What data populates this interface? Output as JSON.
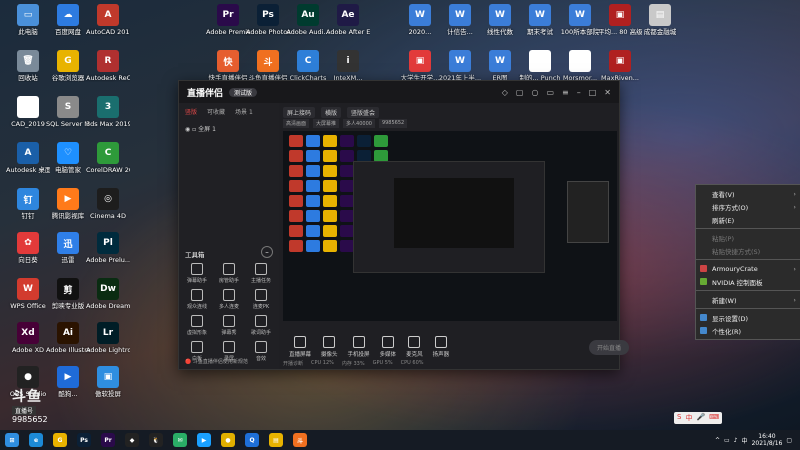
{
  "desktop": {
    "icons": [
      {
        "label": "此电脑",
        "color": "#4a90d9",
        "glyph": "▭"
      },
      {
        "label": "百度网盘",
        "color": "#2d7be0",
        "glyph": "☁"
      },
      {
        "label": "AutoCAD 2019 - 简...",
        "color": "#c0392b",
        "glyph": "A"
      },
      {
        "label": "Adobe Premie...",
        "color": "#2a0a4a",
        "glyph": "Pr"
      },
      {
        "label": "Adobe Photosh...",
        "color": "#0b2036",
        "glyph": "Ps"
      },
      {
        "label": "Adobe Audi...",
        "color": "#003b2f",
        "glyph": "Au"
      },
      {
        "label": "Adobe After Effects CC",
        "color": "#1f1a46",
        "glyph": "Ae"
      },
      {
        "label": "回收站",
        "color": "#7a8a99",
        "glyph": "🗑"
      },
      {
        "label": "谷歌浏览器",
        "color": "#e8b300",
        "glyph": "G"
      },
      {
        "label": "Autodesk ReCap",
        "color": "#b03030",
        "glyph": "R"
      },
      {
        "label": "快手直播伴侣",
        "color": "#e65e2f",
        "glyph": "快"
      },
      {
        "label": "斗鱼直播伴侣",
        "color": "#f07020",
        "glyph": "斗"
      },
      {
        "label": "ClickCharts",
        "color": "#2e7fd8",
        "glyph": "C"
      },
      {
        "label": "InteXM...",
        "color": "#333",
        "glyph": "i"
      },
      {
        "label": "CAD_2019",
        "color": "#fff",
        "glyph": "▤"
      },
      {
        "label": "SQL Server Managem...",
        "color": "#8a8a8a",
        "glyph": "S"
      },
      {
        "label": "3ds Max 2019",
        "color": "#1a6e6e",
        "glyph": "3"
      },
      {
        "label": "Autodesk 桌面应用程序",
        "color": "#1a5fa8",
        "glyph": "A"
      },
      {
        "label": "电脑管家",
        "color": "#1e90ff",
        "glyph": "♡"
      },
      {
        "label": "CorelDRAW 2020 (64...",
        "color": "#2e9a3a",
        "glyph": "C"
      },
      {
        "label": "钉钉",
        "color": "#2e86de",
        "glyph": "钉"
      },
      {
        "label": "腾讯影视库",
        "color": "#ff7a1a",
        "glyph": "▶"
      },
      {
        "label": "Cinema 4D",
        "color": "#1d1d1d",
        "glyph": "◎"
      },
      {
        "label": "向日葵",
        "color": "#e23a3a",
        "glyph": "✿"
      },
      {
        "label": "迅雷",
        "color": "#2f7fe8",
        "glyph": "迅"
      },
      {
        "label": "Adobe Prelu...",
        "color": "#002b3d",
        "glyph": "Pl"
      },
      {
        "label": "WPS Office",
        "color": "#d23b2e",
        "glyph": "W"
      },
      {
        "label": "剪映专业版",
        "color": "#111",
        "glyph": "剪"
      },
      {
        "label": "Adobe Dreamwe...",
        "color": "#0a2c12",
        "glyph": "Dw"
      },
      {
        "label": "Adobe XD",
        "color": "#470137",
        "glyph": "Xd"
      },
      {
        "label": "Adobe Illustrat...",
        "color": "#2b1300",
        "glyph": "Ai"
      },
      {
        "label": "Adobe Lightroo...",
        "color": "#001d26",
        "glyph": "Lr"
      },
      {
        "label": "OBS Studio",
        "color": "#222",
        "glyph": "●"
      },
      {
        "label": "酷狗...",
        "color": "#1f6bd8",
        "glyph": "▶"
      },
      {
        "label": "傲软投屏",
        "color": "#2f8ee0",
        "glyph": "▣"
      },
      {
        "label": "2020...",
        "color": "#3b7dd8",
        "glyph": "W"
      },
      {
        "label": "计信告...",
        "color": "#3b7dd8",
        "glyph": "W"
      },
      {
        "label": "线性代数",
        "color": "#3b7dd8",
        "glyph": "W"
      },
      {
        "label": "期末考试",
        "color": "#3b7dd8",
        "glyph": "W"
      },
      {
        "label": "100所本部院",
        "color": "#3b7dd8",
        "glyph": "W"
      },
      {
        "label": "平均... 80 高级中学",
        "color": "#b02020",
        "glyph": "▣"
      },
      {
        "label": "成都金融城",
        "color": "#c9c9c9",
        "glyph": "▤"
      },
      {
        "label": "大学生开学...",
        "color": "#e23a3a",
        "glyph": "▣"
      },
      {
        "label": "2021年上半...",
        "color": "#3b7dd8",
        "glyph": "W"
      },
      {
        "label": "ER图",
        "color": "#3b7dd8",
        "glyph": "W"
      },
      {
        "label": "制的... Punch",
        "color": "#fff",
        "glyph": "▤"
      },
      {
        "label": "Morsmor...",
        "color": "#fff",
        "glyph": "▤"
      },
      {
        "label": "MaxRiven...",
        "color": "#b02020",
        "glyph": "▣"
      }
    ]
  },
  "app": {
    "name": "直播伴侣",
    "version": "测试版",
    "scene_tabs": [
      "竖版",
      "可收藏",
      "场景 1"
    ],
    "scene_item": "全屏 1",
    "preview_tabs": [
      "屏上接码",
      "横版",
      "竖版盛会"
    ],
    "preview_sub": [
      "高清画面",
      "大屏幕推",
      "多人40000",
      "9985652"
    ],
    "tools_title": "工具箱",
    "tools": [
      "弹幕助手",
      "房管助手",
      "主播任务",
      "观众连线",
      "多人连麦",
      "连麦PK",
      "虚拟形象",
      "弹幕秀",
      "歌词助手",
      "白板",
      "录屏",
      "音效"
    ],
    "notice": "斗鱼直播伴侣使用新规范",
    "bottom_buttons": [
      "直播屏幕",
      "摄像头",
      "手机投屏",
      "多媒体",
      "麦克风",
      "扬声器"
    ],
    "golive": "开始直播",
    "footer_links": [
      "开播诊断",
      "CPU 12%",
      "内存 33%",
      "GPU 5%",
      "CPU 60%"
    ],
    "toolbar_icons": [
      "gift",
      "shop",
      "user",
      "chat",
      "settings",
      "minimize",
      "maximize",
      "close"
    ]
  },
  "context_menu": {
    "items": [
      {
        "label": "查看(V)",
        "submenu": true,
        "disabled": false
      },
      {
        "label": "排序方式(O)",
        "submenu": true,
        "disabled": false
      },
      {
        "label": "刷新(E)",
        "submenu": false,
        "disabled": false
      },
      {
        "sep": true
      },
      {
        "label": "粘贴(P)",
        "submenu": false,
        "disabled": true
      },
      {
        "label": "粘贴快捷方式(S)",
        "submenu": false,
        "disabled": true
      },
      {
        "sep": true
      },
      {
        "label": "ArmouryCrate",
        "submenu": true,
        "disabled": false,
        "icon": "#c44"
      },
      {
        "label": "NVIDIA 控制面板",
        "submenu": false,
        "disabled": false,
        "icon": "#6a3"
      },
      {
        "sep": true
      },
      {
        "label": "新建(W)",
        "submenu": true,
        "disabled": false
      },
      {
        "sep": true
      },
      {
        "label": "显示设置(D)",
        "submenu": false,
        "disabled": false,
        "icon": "#48c"
      },
      {
        "label": "个性化(R)",
        "submenu": false,
        "disabled": false,
        "icon": "#48c"
      }
    ]
  },
  "watermark": {
    "logo": "斗鱼",
    "sub": "直播号",
    "id": "9985652"
  },
  "taskbar": {
    "apps": [
      {
        "name": "start",
        "color": "#2f8ee0",
        "glyph": "⊞"
      },
      {
        "name": "edge",
        "color": "#1c8ad6",
        "glyph": "e"
      },
      {
        "name": "chrome",
        "color": "#e8b300",
        "glyph": "G"
      },
      {
        "name": "photoshop",
        "color": "#0b2036",
        "glyph": "Ps"
      },
      {
        "name": "premiere",
        "color": "#2a0a4a",
        "glyph": "Pr"
      },
      {
        "name": "app-black",
        "color": "#222",
        "glyph": "◆"
      },
      {
        "name": "tencent",
        "color": "#222",
        "glyph": "🐧"
      },
      {
        "name": "wechat",
        "color": "#2aae67",
        "glyph": "✉"
      },
      {
        "name": "video",
        "color": "#1aa0ff",
        "glyph": "▶"
      },
      {
        "name": "app-yellow",
        "color": "#e0b000",
        "glyph": "●"
      },
      {
        "name": "app-chat",
        "color": "#1e6fd8",
        "glyph": "Q"
      },
      {
        "name": "files",
        "color": "#e8b300",
        "glyph": "▤"
      },
      {
        "name": "douyu",
        "color": "#f07020",
        "glyph": "斗"
      }
    ],
    "ime": "中",
    "time": "16:40",
    "date": "2021/8/16"
  }
}
